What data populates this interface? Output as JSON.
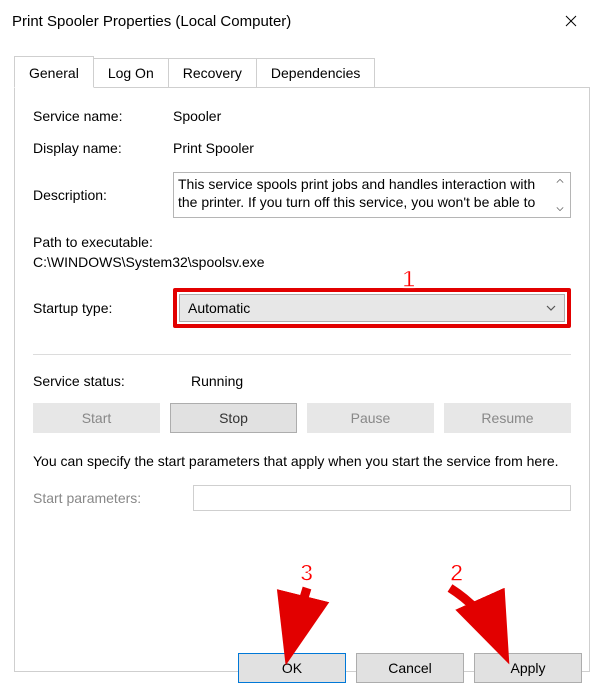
{
  "window": {
    "title": "Print Spooler Properties (Local Computer)"
  },
  "tabs": {
    "general": "General",
    "logon": "Log On",
    "recovery": "Recovery",
    "dependencies": "Dependencies"
  },
  "labels": {
    "service_name": "Service name:",
    "display_name": "Display name:",
    "description": "Description:",
    "path": "Path to executable:",
    "startup_type": "Startup type:",
    "service_status": "Service status:",
    "params_hint": "You can specify the start parameters that apply when you start the service from here.",
    "start_params": "Start parameters:"
  },
  "values": {
    "service_name": "Spooler",
    "display_name": "Print Spooler",
    "description": "This service spools print jobs and handles interaction with the printer.  If you turn off this service, you won't be able to print or see your printers.",
    "exe_path": "C:\\WINDOWS\\System32\\spoolsv.exe",
    "startup_selected": "Automatic",
    "status": "Running",
    "start_params": ""
  },
  "service_buttons": {
    "start": "Start",
    "stop": "Stop",
    "pause": "Pause",
    "resume": "Resume"
  },
  "dialog_buttons": {
    "ok": "OK",
    "cancel": "Cancel",
    "apply": "Apply"
  },
  "annotations": {
    "n1": "1",
    "n2": "2",
    "n3": "3"
  }
}
